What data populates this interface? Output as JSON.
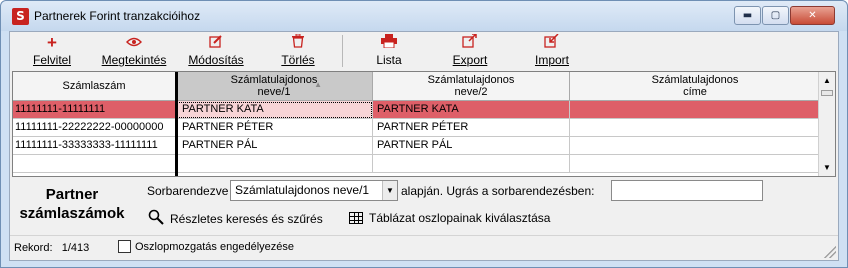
{
  "window": {
    "title": "Partnerek Forint tranzakcióihoz",
    "app_icon_glyph": "S",
    "controls": {
      "minimize": "▬",
      "maximize": "▢",
      "close": "✕"
    }
  },
  "toolbar": {
    "buttons": [
      {
        "id": "new",
        "label": "Felvitel",
        "icon": "plus-icon",
        "glyph": "+",
        "color": "#c8231f"
      },
      {
        "id": "view",
        "label": "Megtekintés",
        "icon": "eye-icon",
        "glyph": "👁",
        "color": "#c8231f"
      },
      {
        "id": "edit",
        "label": "Módosítás",
        "icon": "edit-icon",
        "glyph": "✎",
        "color": "#c8231f"
      },
      {
        "id": "delete",
        "label": "Törlés",
        "icon": "trash-icon",
        "glyph": "🗑",
        "color": "#c8231f"
      },
      {
        "id": "list",
        "label": "Lista",
        "icon": "printer-icon",
        "glyph": "🖶",
        "color": "#c8231f"
      },
      {
        "id": "export",
        "label": "Export",
        "icon": "export-icon",
        "glyph": "↗",
        "color": "#c8231f"
      },
      {
        "id": "import",
        "label": "Import",
        "icon": "import-icon",
        "glyph": "↙",
        "color": "#c8231f"
      }
    ]
  },
  "grid": {
    "columns": [
      {
        "label": "Számlaszám",
        "sorted": false
      },
      {
        "label": "Számlatulajdonos neve/1",
        "sorted": true,
        "sort_indicator": "▲"
      },
      {
        "label": "Számlatulajdonos neve/2",
        "sorted": false
      },
      {
        "label": "Számlatulajdonos címe",
        "sorted": false
      }
    ],
    "rows": [
      {
        "cells": [
          "11111111-11111111",
          "PARTNER KATA",
          "PARTNER KATA",
          ""
        ],
        "selected": true
      },
      {
        "cells": [
          "11111111-22222222-00000000",
          "PARTNER PÉTER",
          "PARTNER PÉTER",
          ""
        ],
        "selected": false
      },
      {
        "cells": [
          "11111111-33333333-11111111",
          "PARTNER PÁL",
          "PARTNER PÁL",
          ""
        ],
        "selected": false
      },
      {
        "cells": [
          "",
          "",
          "",
          ""
        ],
        "selected": false
      }
    ],
    "selection_color": "#de5f68"
  },
  "panel": {
    "title": "Partner számlaszámok",
    "sort_label": "Sorbarendezve",
    "sort_value": "Számlatulajdonos neve/1",
    "sort_after": "alapján.  Ugrás a sorbarendezésben:",
    "jump_value": "",
    "search_link": "Részletes keresés és szűrés",
    "columns_link": "Táblázat oszlopainak kiválasztása"
  },
  "status": {
    "record_label": "Rekord:",
    "record_value": "1/413",
    "column_move_label": "Oszlopmozgatás engedélyezése",
    "column_move_checked": false
  }
}
